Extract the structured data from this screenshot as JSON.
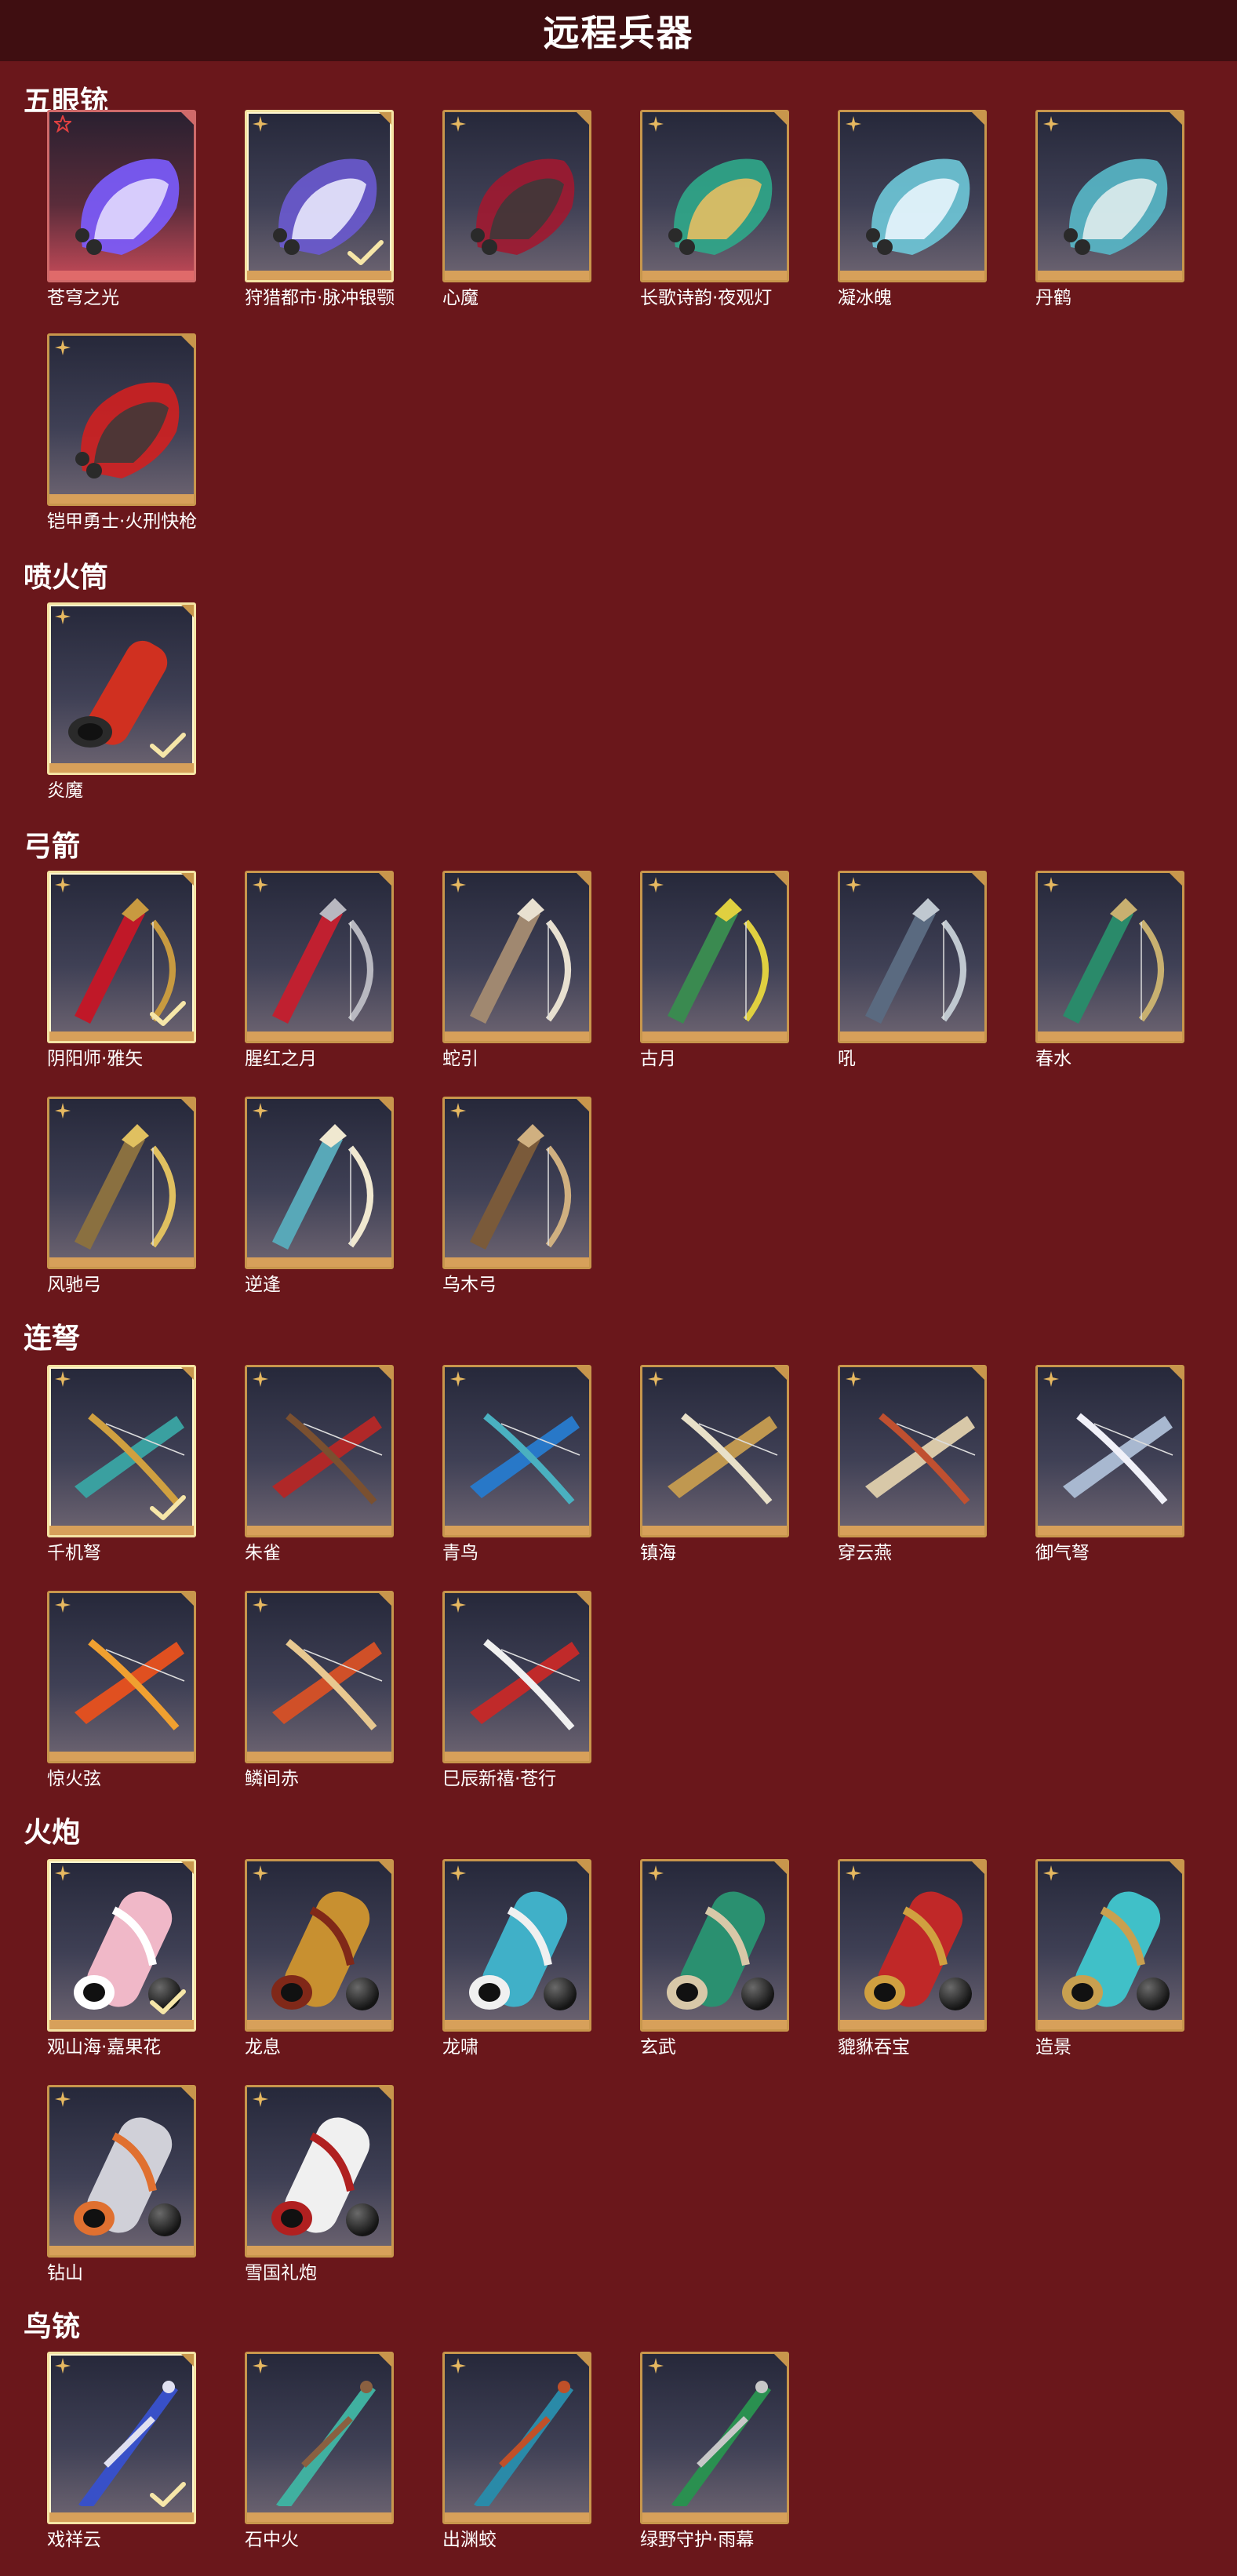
{
  "page_title": "远程兵器",
  "colors": {
    "background": "#6a171b",
    "header_bar": "#3f0e11",
    "card_border": "#c8964c",
    "selected_border": "#f4e3a3"
  },
  "sections": [
    {
      "title": "五眼铳",
      "items": [
        {
          "name": "苍穹之光",
          "rank": "star-icon",
          "selected": false,
          "art": "gauntlet",
          "tint": [
            "#7b5cff",
            "#e8e0ff"
          ]
        },
        {
          "name": "狩猎都市·脉冲银颚",
          "rank": "sparkle-icon",
          "selected": true,
          "art": "gauntlet",
          "tint": [
            "#6a5ad0",
            "#f0f0ff"
          ]
        },
        {
          "name": "心魔",
          "rank": "sparkle-icon",
          "selected": false,
          "art": "gauntlet",
          "tint": [
            "#a01830",
            "#3a3a3a"
          ]
        },
        {
          "name": "长歌诗韵·夜观灯",
          "rank": "sparkle-icon",
          "selected": false,
          "art": "gauntlet",
          "tint": [
            "#2fa88a",
            "#f0c060"
          ]
        },
        {
          "name": "凝冰魄",
          "rank": "sparkle-icon",
          "selected": false,
          "art": "gauntlet",
          "tint": [
            "#6ec8d8",
            "#f0f8ff"
          ]
        },
        {
          "name": "丹鹤",
          "rank": "sparkle-icon",
          "selected": false,
          "art": "gauntlet",
          "tint": [
            "#58b8c8",
            "#e8f0f0"
          ]
        },
        {
          "name": "铠甲勇士·火刑快枪",
          "rank": "sparkle-icon",
          "selected": false,
          "art": "gauntlet",
          "tint": [
            "#d02020",
            "#3a3a3a"
          ]
        }
      ]
    },
    {
      "title": "喷火筒",
      "items": [
        {
          "name": "炎魔",
          "rank": "sparkle-icon",
          "selected": true,
          "art": "tube",
          "tint": [
            "#d03020",
            "#2a2a2a"
          ]
        }
      ]
    },
    {
      "title": "弓箭",
      "items": [
        {
          "name": "阴阳师·雅矢",
          "rank": "sparkle-icon",
          "selected": true,
          "art": "bow",
          "tint": [
            "#c01828",
            "#c89a40"
          ]
        },
        {
          "name": "腥红之月",
          "rank": "sparkle-icon",
          "selected": false,
          "art": "bow",
          "tint": [
            "#c02030",
            "#b8b8c0"
          ]
        },
        {
          "name": "蛇引",
          "rank": "sparkle-icon",
          "selected": false,
          "art": "bow",
          "tint": [
            "#a08870",
            "#e8e0d0"
          ]
        },
        {
          "name": "古月",
          "rank": "sparkle-icon",
          "selected": false,
          "art": "bow",
          "tint": [
            "#3a8a50",
            "#e0d040"
          ]
        },
        {
          "name": "吼",
          "rank": "sparkle-icon",
          "selected": false,
          "art": "bow",
          "tint": [
            "#5a6a80",
            "#c0c8d0"
          ]
        },
        {
          "name": "春水",
          "rank": "sparkle-icon",
          "selected": false,
          "art": "bow",
          "tint": [
            "#2a8a6a",
            "#c8b070"
          ]
        },
        {
          "name": "风驰弓",
          "rank": "sparkle-icon",
          "selected": false,
          "art": "bow",
          "tint": [
            "#8a7040",
            "#e0c060"
          ]
        },
        {
          "name": "逆逢",
          "rank": "sparkle-icon",
          "selected": false,
          "art": "bow",
          "tint": [
            "#58a8b8",
            "#f0e8d0"
          ]
        },
        {
          "name": "乌木弓",
          "rank": "sparkle-icon",
          "selected": false,
          "art": "bow",
          "tint": [
            "#7a5a3a",
            "#d0b080"
          ]
        }
      ]
    },
    {
      "title": "连弩",
      "items": [
        {
          "name": "千机弩",
          "rank": "sparkle-icon",
          "selected": true,
          "art": "crossbow",
          "tint": [
            "#3aa0a0",
            "#d0a040"
          ]
        },
        {
          "name": "朱雀",
          "rank": "sparkle-icon",
          "selected": false,
          "art": "crossbow",
          "tint": [
            "#b02828",
            "#7a5030"
          ]
        },
        {
          "name": "青鸟",
          "rank": "sparkle-icon",
          "selected": false,
          "art": "crossbow",
          "tint": [
            "#2878c8",
            "#4ab0c0"
          ]
        },
        {
          "name": "镇海",
          "rank": "sparkle-icon",
          "selected": false,
          "art": "crossbow",
          "tint": [
            "#c09850",
            "#e8e0c8"
          ]
        },
        {
          "name": "穿云燕",
          "rank": "sparkle-icon",
          "selected": false,
          "art": "crossbow",
          "tint": [
            "#d8c8a8",
            "#c05030"
          ]
        },
        {
          "name": "御气弩",
          "rank": "sparkle-icon",
          "selected": false,
          "art": "crossbow",
          "tint": [
            "#a8b8d0",
            "#f0f0f8"
          ]
        },
        {
          "name": "惊火弦",
          "rank": "sparkle-icon",
          "selected": false,
          "art": "crossbow",
          "tint": [
            "#e05020",
            "#f0a030"
          ]
        },
        {
          "name": "鳞间赤",
          "rank": "sparkle-icon",
          "selected": false,
          "art": "crossbow",
          "tint": [
            "#d05028",
            "#e8c890"
          ]
        },
        {
          "name": "巳辰新禧·苍行",
          "rank": "sparkle-icon",
          "selected": false,
          "art": "crossbow",
          "tint": [
            "#c02a2a",
            "#f0f0f0"
          ]
        }
      ]
    },
    {
      "title": "火炮",
      "items": [
        {
          "name": "观山海·嘉果花",
          "rank": "sparkle-icon",
          "selected": true,
          "art": "cannon",
          "tint": [
            "#f0b8c8",
            "#ffffff"
          ]
        },
        {
          "name": "龙息",
          "rank": "sparkle-icon",
          "selected": false,
          "art": "cannon",
          "tint": [
            "#c89030",
            "#802818"
          ]
        },
        {
          "name": "龙啸",
          "rank": "sparkle-icon",
          "selected": false,
          "art": "cannon",
          "tint": [
            "#40b0c8",
            "#f0f0f0"
          ]
        },
        {
          "name": "玄武",
          "rank": "sparkle-icon",
          "selected": false,
          "art": "cannon",
          "tint": [
            "#2a9070",
            "#d8c8a8"
          ]
        },
        {
          "name": "貔貅吞宝",
          "rank": "sparkle-icon",
          "selected": false,
          "art": "cannon",
          "tint": [
            "#c02828",
            "#d0a040"
          ]
        },
        {
          "name": "造景",
          "rank": "sparkle-icon",
          "selected": false,
          "art": "cannon",
          "tint": [
            "#40c0c8",
            "#c8a050"
          ]
        },
        {
          "name": "钻山",
          "rank": "sparkle-icon",
          "selected": false,
          "art": "cannon",
          "tint": [
            "#d0d0d8",
            "#e07030"
          ]
        },
        {
          "name": "雪国礼炮",
          "rank": "sparkle-icon",
          "selected": false,
          "art": "cannon",
          "tint": [
            "#f0f0f0",
            "#b02020"
          ]
        }
      ]
    },
    {
      "title": "鸟铳",
      "items": [
        {
          "name": "戏祥云",
          "rank": "sparkle-icon",
          "selected": true,
          "art": "rifle",
          "tint": [
            "#3850c8",
            "#e0e0f0"
          ]
        },
        {
          "name": "石中火",
          "rank": "sparkle-icon",
          "selected": false,
          "art": "rifle",
          "tint": [
            "#40b0a0",
            "#8a6040"
          ]
        },
        {
          "name": "出渊蛟",
          "rank": "sparkle-icon",
          "selected": false,
          "art": "rifle",
          "tint": [
            "#2a8aa8",
            "#c05028"
          ]
        },
        {
          "name": "绿野守护·雨幕",
          "rank": "sparkle-icon",
          "selected": false,
          "art": "rifle",
          "tint": [
            "#2a9050",
            "#c8c8c8"
          ]
        }
      ]
    }
  ]
}
